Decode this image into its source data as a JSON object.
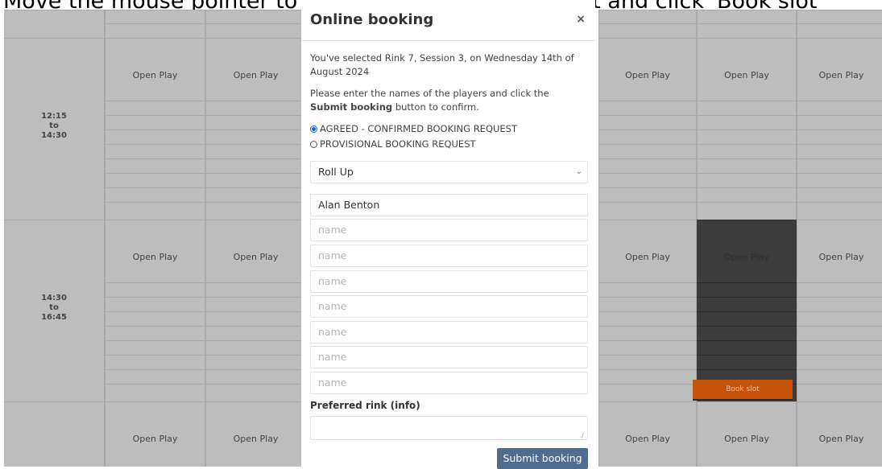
{
  "instruction": "Move the mouse pointer to the available rink you want and click 'Book slot'",
  "times": [
    {
      "from": "12:15",
      "sep": "to",
      "to": "14:30"
    },
    {
      "from": "14:30",
      "sep": "to",
      "to": "16:45"
    }
  ],
  "open_play": "Open Play",
  "book_slot": "Book slot",
  "modal": {
    "title": "Online booking",
    "close": "×",
    "selection_text": "You've selected Rink 7, Session 3, on Wednesday 14th of August 2024",
    "instructions_pre": "Please enter the names of the players and click the ",
    "instructions_bold": "Submit booking",
    "instructions_post": " button to confirm.",
    "radio_agreed": "AGREED - CONFIRMED BOOKING REQUEST",
    "radio_provisional": "PROVISIONAL BOOKING REQUEST",
    "radio_selected": "AGREED - CONFIRMED BOOKING REQUEST",
    "booking_type": "Roll Up",
    "player1": "Alan Benton",
    "name_placeholder": "name",
    "preferred_label": "Preferred rink (info)",
    "preferred_value": "",
    "submit": "Submit booking"
  }
}
